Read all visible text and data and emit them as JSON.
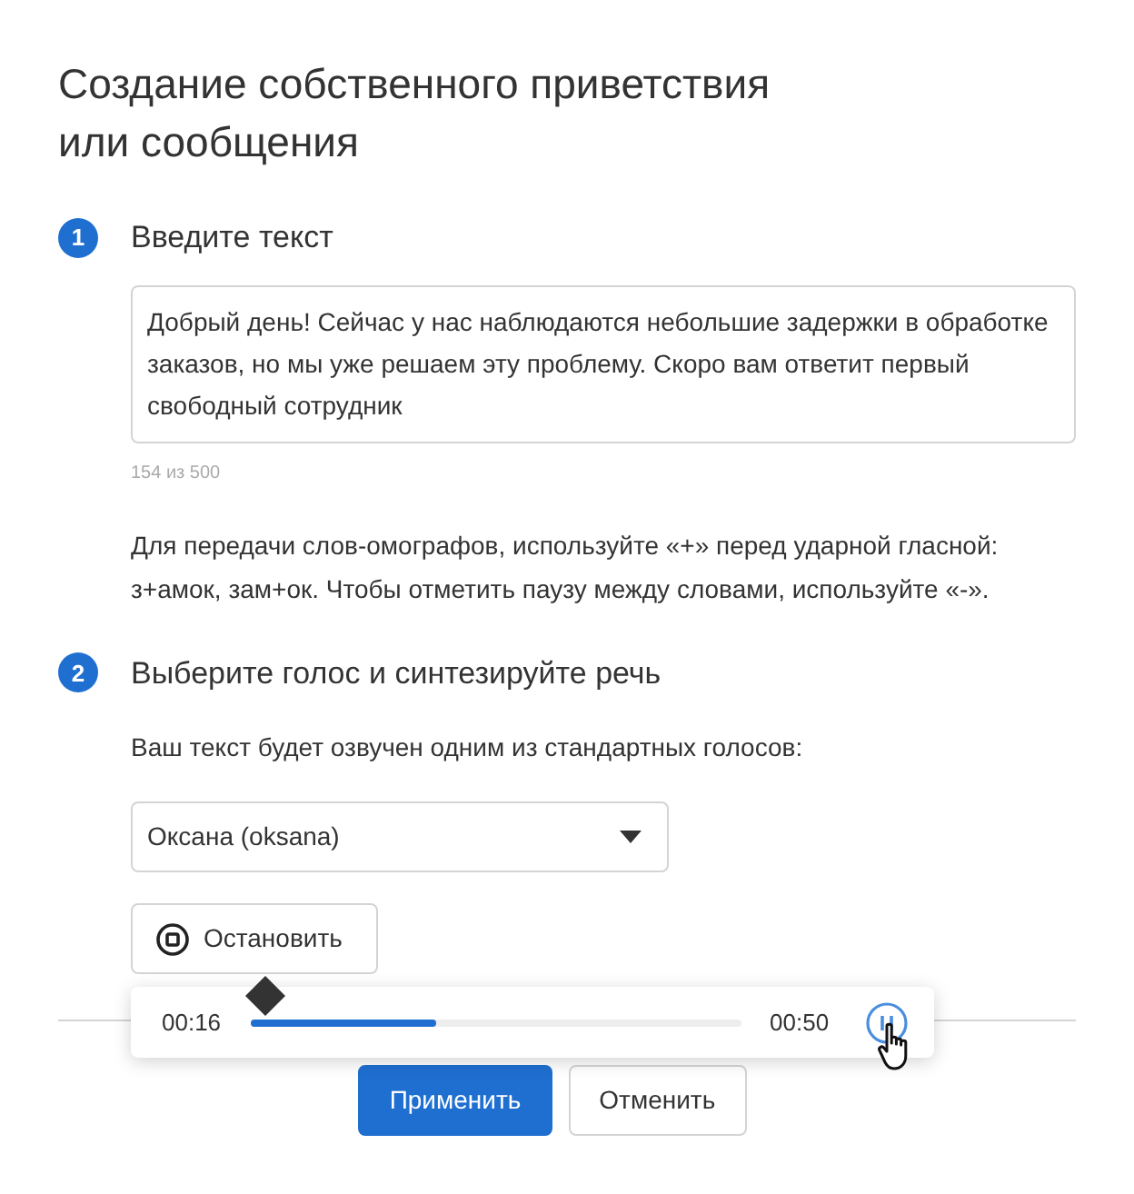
{
  "title": "Создание собственного приветствия или сообщения",
  "steps": [
    {
      "number": "1",
      "heading": "Введите текст"
    },
    {
      "number": "2",
      "heading": "Выберите голос и синтезируйте речь"
    }
  ],
  "message": {
    "value": "Добрый день! Сейчас у нас наблюдаются небольшие задержки в обработке заказов, но мы уже решаем эту проблему. Скоро вам ответит первый свободный сотрудник",
    "counter": "154 из 500"
  },
  "hint": "Для передачи слов-омографов, используйте «+» перед ударной гласной: з+амок, зам+ок. Чтобы отметить паузу между словами, используйте «-».",
  "voice_note": "Ваш текст будет озвучен одним из стандартных голосов:",
  "voice_select": {
    "value": "Оксана (oksana)"
  },
  "stop_button": "Остановить",
  "player": {
    "elapsed": "00:16",
    "total": "00:50",
    "level": 0.38,
    "playing": true
  },
  "buttons": [
    {
      "label": "Применить",
      "kind": "primary"
    },
    {
      "label": "Отменить",
      "kind": "secondary"
    }
  ]
}
